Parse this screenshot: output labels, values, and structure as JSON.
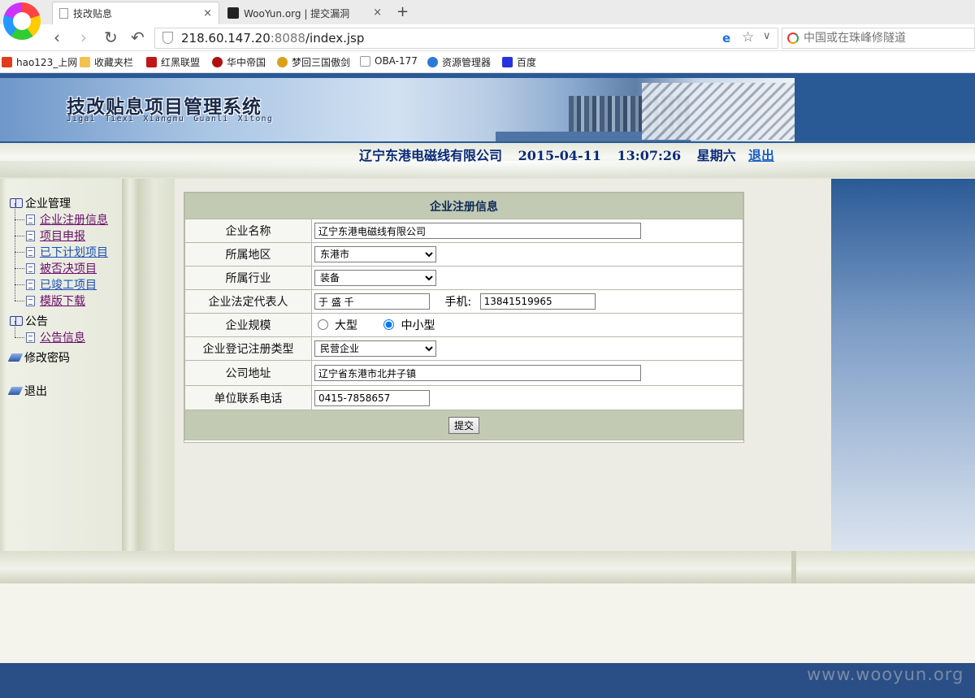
{
  "browser": {
    "tabs": [
      {
        "title": "技改贴息",
        "active": true
      },
      {
        "title": "WooYun.org | 提交漏洞",
        "active": false
      }
    ],
    "tab_close": "×",
    "new_tab": "+",
    "url_host": "218.60.147.20",
    "url_port": ":8088",
    "url_path": "/index.jsp",
    "search_placeholder": "中国或在珠峰修隧道",
    "nav_icons": {
      "back": "‹",
      "forward": "›",
      "reload": "↻",
      "undo": "↶",
      "star": "☆",
      "dropdown": "∨",
      "ie": "e"
    },
    "bookmarks": [
      {
        "label": "hao123_上网",
        "icon": "hao123-icon",
        "color": "#e03c1c"
      },
      {
        "label": "收藏夹栏",
        "icon": "folder-icon",
        "color": "#f2c14e"
      },
      {
        "label": "红黑联盟",
        "icon": "shield-icon",
        "color": "#c01818"
      },
      {
        "label": "华中帝国",
        "icon": "hand-icon",
        "color": "#b01010"
      },
      {
        "label": "梦回三国傲剑",
        "icon": "game-icon",
        "color": "#d9a11a"
      },
      {
        "label": "OBA-177",
        "icon": "page-icon",
        "color": "#ffffff"
      },
      {
        "label": "资源管理器",
        "icon": "explorer-icon",
        "color": "#2b7bd6"
      },
      {
        "label": "百度",
        "icon": "baidu-icon",
        "color": "#2932e1"
      }
    ]
  },
  "header": {
    "system_title": "技改贴息项目管理系统",
    "system_subtitle": "Jigai Tiexi Xiangmu Guanli Xitong",
    "company": "辽宁东港电磁线有限公司",
    "date": "2015-04-11",
    "time": "13:07:26",
    "weekday": "星期六",
    "logout": "退出"
  },
  "sidebar": {
    "groups": [
      {
        "label": "企业管理",
        "items": [
          {
            "label": "企业注册信息",
            "visited": true
          },
          {
            "label": "项目申报",
            "visited": true
          },
          {
            "label": "已下计划项目",
            "visited": false
          },
          {
            "label": "被否决项目",
            "visited": true
          },
          {
            "label": "已竣工项目",
            "visited": false
          },
          {
            "label": "模版下载",
            "visited": true
          }
        ]
      },
      {
        "label": "公告",
        "items": [
          {
            "label": "公告信息",
            "visited": true
          }
        ]
      }
    ],
    "change_password": "修改密码",
    "logout": "退出"
  },
  "form": {
    "title": "企业注册信息",
    "labels": {
      "name": "企业名称",
      "region": "所属地区",
      "industry": "所属行业",
      "legal_rep": "企业法定代表人",
      "mobile": "手机:",
      "scale": "企业规模",
      "reg_type": "企业登记注册类型",
      "address": "公司地址",
      "phone": "单位联系电话"
    },
    "values": {
      "name": "辽宁东港电磁线有限公司",
      "region": "东港市",
      "industry": "装备",
      "legal_rep": "于 盛 千",
      "mobile": "13841519965",
      "scale_large": "大型",
      "scale_small": "中小型",
      "scale_selected": "中小型",
      "reg_type": "民营企业",
      "address": "辽宁省东港市北井子镇",
      "phone": "0415-7858657"
    },
    "submit": "提交"
  },
  "watermark": "www.wooyun.org",
  "colors": {
    "page_blue": "#2a5a96",
    "bottom_blue": "#2a4e86",
    "form_header": "#c3cab4",
    "info_text": "#0a2a7a",
    "link_blue": "#1a5fc8",
    "visited_link": "#6b0d6b"
  }
}
